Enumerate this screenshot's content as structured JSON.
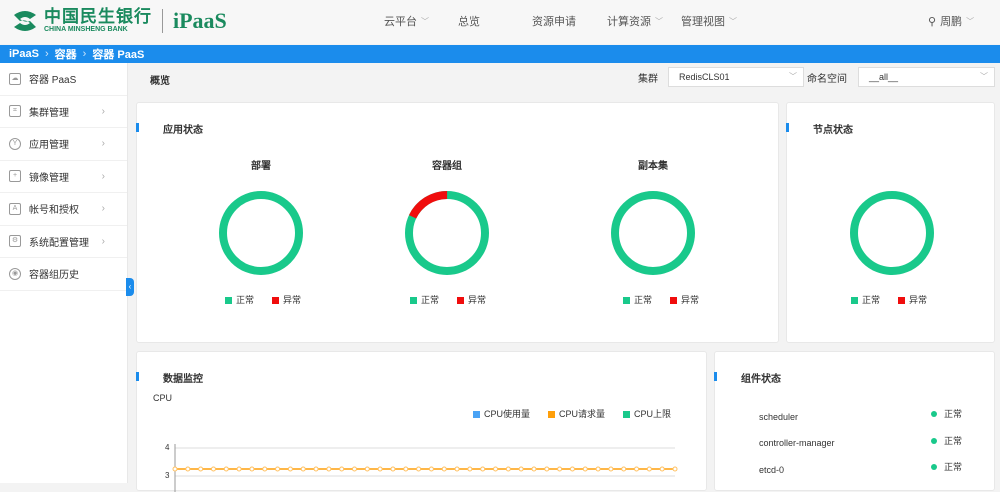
{
  "header": {
    "logo_cn": "中国民生银行",
    "logo_en": "CHINA MINSHENG BANK",
    "product": "iPaaS",
    "nav": [
      {
        "label": "云平台",
        "dropdown": true
      },
      {
        "label": "总览",
        "dropdown": false
      },
      {
        "label": "资源申请",
        "dropdown": false
      },
      {
        "label": "计算资源",
        "dropdown": true
      },
      {
        "label": "管理视图",
        "dropdown": true
      }
    ],
    "user": "周鹏"
  },
  "breadcrumb": [
    "iPaaS",
    "容器",
    "容器 PaaS"
  ],
  "sidebar": {
    "items": [
      {
        "label": "容器 PaaS"
      },
      {
        "label": "集群管理"
      },
      {
        "label": "应用管理"
      },
      {
        "label": "镜像管理"
      },
      {
        "label": "帐号和授权"
      },
      {
        "label": "系统配置管理"
      },
      {
        "label": "容器组历史"
      }
    ]
  },
  "page": {
    "title": "概览",
    "cluster_label": "集群",
    "cluster_value": "RedisCLS01",
    "ns_label": "命名空间",
    "ns_value": "__all__"
  },
  "colors": {
    "normal": "#19c98b",
    "abnormal": "#f00d0d",
    "accent": "#1b8cec"
  },
  "app_status": {
    "title": "应用状态",
    "legend_normal": "正常",
    "legend_abnormal": "异常",
    "donuts": [
      {
        "title": "部署",
        "normal_fraction": 1.0
      },
      {
        "title": "容器组",
        "normal_fraction": 0.82
      },
      {
        "title": "副本集",
        "normal_fraction": 1.0
      }
    ]
  },
  "node_status": {
    "title": "节点状态",
    "normal_fraction": 1.0,
    "legend_normal": "正常",
    "legend_abnormal": "异常"
  },
  "monitor": {
    "title": "数据监控",
    "chart_label": "CPU",
    "legend": [
      {
        "name": "CPU使用量",
        "color": "#4aa3f5"
      },
      {
        "name": "CPU请求量",
        "color": "#ff9f0a"
      },
      {
        "name": "CPU上限",
        "color": "#19c98b"
      }
    ],
    "y_ticks": [
      "4",
      "3"
    ],
    "request_value": 3.25,
    "points": 40
  },
  "components": {
    "title": "组件状态",
    "items": [
      {
        "name": "scheduler",
        "status": "正常"
      },
      {
        "name": "controller-manager",
        "status": "正常"
      },
      {
        "name": "etcd-0",
        "status": "正常"
      }
    ]
  }
}
